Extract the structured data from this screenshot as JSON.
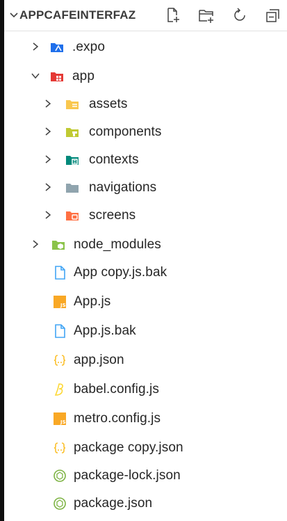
{
  "explorer": {
    "title": "APPCAFEINTERFAZ",
    "actions": [
      "new-file-icon",
      "new-folder-icon",
      "refresh-icon",
      "collapse-all-icon"
    ]
  },
  "tree": [
    {
      "label": ".expo",
      "type": "folder",
      "expanded": false,
      "depth": 0,
      "icon": "expo-folder-icon",
      "color": "#1f6feb"
    },
    {
      "label": "app",
      "type": "folder",
      "expanded": true,
      "depth": 0,
      "icon": "app-folder-icon",
      "color": "#e53935"
    },
    {
      "label": "assets",
      "type": "folder",
      "expanded": false,
      "depth": 1,
      "icon": "assets-folder-icon",
      "color": "#f9c74f"
    },
    {
      "label": "components",
      "type": "folder",
      "expanded": false,
      "depth": 1,
      "icon": "components-folder-icon",
      "color": "#c0ca33"
    },
    {
      "label": "contexts",
      "type": "folder",
      "expanded": false,
      "depth": 1,
      "icon": "contexts-folder-icon",
      "color": "#00897b"
    },
    {
      "label": "navigations",
      "type": "folder",
      "expanded": false,
      "depth": 1,
      "icon": "folder-icon",
      "color": "#90a4ae"
    },
    {
      "label": "screens",
      "type": "folder",
      "expanded": false,
      "depth": 1,
      "icon": "screens-folder-icon",
      "color": "#ff7043"
    },
    {
      "label": "node_modules",
      "type": "folder",
      "expanded": false,
      "depth": 0,
      "icon": "node-modules-folder-icon",
      "color": "#8bc34a"
    },
    {
      "label": "App copy.js.bak",
      "type": "file",
      "depth": 0,
      "icon": "file-icon",
      "color": "#42a5f5"
    },
    {
      "label": "App.js",
      "type": "file",
      "depth": 0,
      "icon": "javascript-icon",
      "color": "#f9a825"
    },
    {
      "label": "App.js.bak",
      "type": "file",
      "depth": 0,
      "icon": "file-icon",
      "color": "#42a5f5"
    },
    {
      "label": "app.json",
      "type": "file",
      "depth": 0,
      "icon": "json-icon",
      "color": "#fbc02d"
    },
    {
      "label": "babel.config.js",
      "type": "file",
      "depth": 0,
      "icon": "babel-icon",
      "color": "#fdd835"
    },
    {
      "label": "metro.config.js",
      "type": "file",
      "depth": 0,
      "icon": "javascript-icon",
      "color": "#f9a825"
    },
    {
      "label": "package copy.json",
      "type": "file",
      "depth": 0,
      "icon": "json-icon",
      "color": "#fbc02d"
    },
    {
      "label": "package-lock.json",
      "type": "file",
      "depth": 0,
      "icon": "npm-icon",
      "color": "#7cb342"
    },
    {
      "label": "package.json",
      "type": "file",
      "depth": 0,
      "icon": "npm-icon",
      "color": "#7cb342"
    }
  ]
}
